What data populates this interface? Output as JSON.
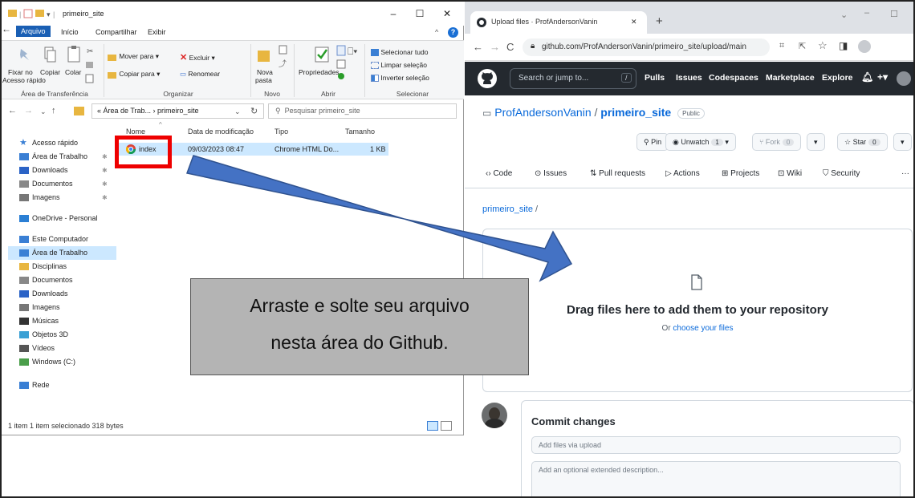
{
  "explorer": {
    "title": "primeiro_site",
    "tabs": {
      "file": "Arquivo",
      "home": "Início",
      "share": "Compartilhar",
      "view": "Exibir"
    },
    "ribbon": {
      "pin": "Fixar no",
      "pin2": "Acesso rápido",
      "copy": "Copiar",
      "paste": "Colar",
      "move_to": "Mover para ▾",
      "copy_to": "Copiar para ▾",
      "delete": "Excluir ▾",
      "rename": "Renomear",
      "new_folder": "Nova",
      "new_folder2": "pasta",
      "properties": "Propriedades",
      "select_all": "Selecionar tudo",
      "clear_sel": "Limpar seleção",
      "invert_sel": "Inverter seleção",
      "g_clipboard": "Área de Transferência",
      "g_organize": "Organizar",
      "g_new": "Novo",
      "g_open": "Abrir",
      "g_select": "Selecionar"
    },
    "address": "« Área de Trab...  ›  primeiro_site",
    "search_placeholder": "Pesquisar primeiro_site",
    "sidebar": [
      "Acesso rápido",
      "Área de Trabalho",
      "Downloads",
      "Documentos",
      "Imagens",
      "OneDrive - Personal",
      "Este Computador",
      "Área de Trabalho",
      "Disciplinas",
      "Documentos",
      "Downloads",
      "Imagens",
      "Músicas",
      "Objetos 3D",
      "Vídeos",
      "Windows (C:)",
      "Rede"
    ],
    "columns": {
      "name": "Nome",
      "date": "Data de modificação",
      "type": "Tipo",
      "size": "Tamanho"
    },
    "file": {
      "name": "index",
      "date": "09/03/2023 08:47",
      "type": "Chrome HTML Do...",
      "size": "1 KB"
    },
    "status": "1 item    1 item selecionado  318 bytes"
  },
  "browser": {
    "tab_title": "Upload files · ProfAndersonVanin",
    "url": "github.com/ProfAndersonVanin/primeiro_site/upload/main",
    "search": "Search or jump to...",
    "slash": "/",
    "nav": [
      "Pulls",
      "Issues",
      "Codespaces",
      "Marketplace",
      "Explore"
    ],
    "owner": "ProfAndersonVanin",
    "sep": " / ",
    "repo": "primeiro_site",
    "visibility": "Public",
    "pin": "Pin",
    "unwatch": "Unwatch",
    "watch_count": "1",
    "fork": "Fork",
    "fork_count": "0",
    "star": "Star",
    "star_count": "0",
    "repo_tabs": [
      "Code",
      "Issues",
      "Pull requests",
      "Actions",
      "Projects",
      "Wiki",
      "Security"
    ],
    "breadcrumb": "primeiro_site",
    "breadcrumb_sep": " /",
    "drop_text": "Drag files here to add them to your repository",
    "or": "Or ",
    "choose": "choose your files",
    "commit_title": "Commit changes",
    "commit_msg_placeholder": "Add files via upload",
    "commit_desc_placeholder": "Add an optional extended description..."
  },
  "callout": {
    "line1": "Arraste e solte seu arquivo",
    "line2": "nesta área do Github."
  },
  "colors": {
    "gh_dark": "#24292f",
    "gh_link": "#0969da",
    "win_blue": "#1a5fb4",
    "selection": "#cce8ff",
    "arrow": "#4472c4",
    "highlight": "#e00000"
  }
}
